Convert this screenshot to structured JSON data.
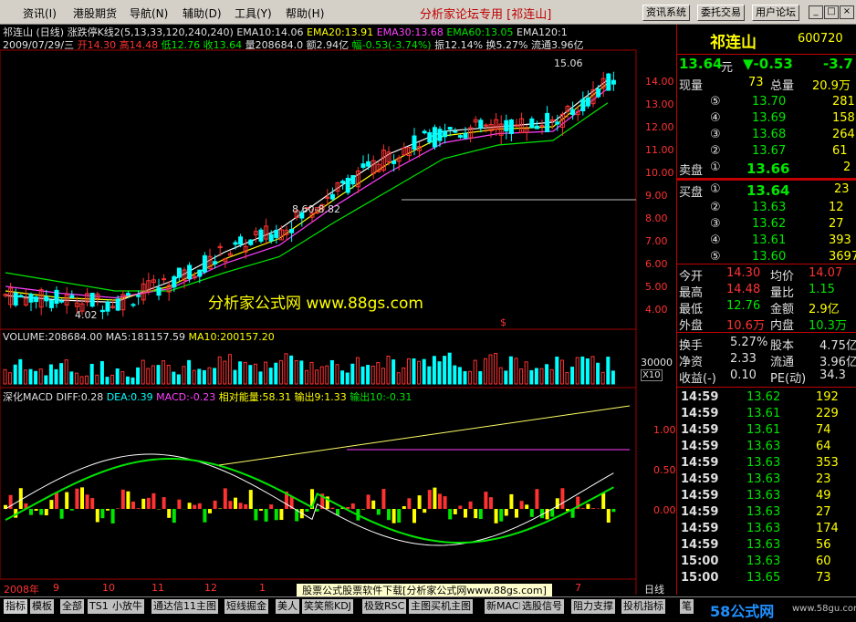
{
  "menu": [
    "资讯(I)",
    "港股期货",
    "导航(N)",
    "辅助(D)",
    "工具(Y)",
    "帮助(H)"
  ],
  "app_title": "分析家论坛专用 [祁连山]",
  "top_buttons": [
    "资讯系统",
    "委托交易",
    "用户论坛"
  ],
  "window_buttons": [
    "_",
    "□",
    "×"
  ],
  "chart": {
    "header_line1": {
      "name": "祁连山 (日线) 涨跌停K线2(5,13,33,120,240,240)",
      "ema10": "EMA10:14.06",
      "ema20": "EMA20:13.91",
      "ema30": "EMA30:13.68",
      "ema60": "EMA60:13.05",
      "ema120": "EMA120:1"
    },
    "header_line2": {
      "date": "2009/07/29/三",
      "open": "开14.30",
      "high": "高14.48",
      "low": "低12.76",
      "close": "收13.64",
      "volume": "量208684.0",
      "amount": "额2.94亿",
      "change": "幅-0.53(-3.74%)",
      "amplitude": "振12.14%",
      "turnover": "换5.27%",
      "float": "流通3.96亿"
    },
    "price_axis": [
      "14.00",
      "13.00",
      "12.00",
      "11.00",
      "10.00",
      "9.00",
      "8.00",
      "7.00",
      "6.00",
      "5.00",
      "4.00"
    ],
    "annotations": {
      "high_mark": "15.06",
      "low_mark": "4.02",
      "range_mark": "8.60-8.82",
      "watermark": "分析家公式网 www.88gs.com",
      "dollar": "$"
    },
    "volume_header": {
      "volume": "VOLUME:208684.00",
      "ma5": "MA5:181157.59",
      "ma10": "MA10:200157.20"
    },
    "volume_axis": [
      "30000",
      "X10"
    ],
    "macd_header": {
      "name": "深化MACD",
      "diff": "DIFF:0.28",
      "dea": "DEA:0.39",
      "macd": "MACD:-0.23",
      "energy": "相对能量:58.31",
      "out9": "输出9:1.33",
      "out10": "输出10:-0.31"
    },
    "macd_axis": [
      "1.00",
      "0.50",
      "0.00"
    ],
    "time_axis": [
      "2008年",
      "9",
      "10",
      "11",
      "12",
      "1",
      "2",
      "3",
      "4",
      "5",
      "6",
      "7"
    ],
    "period": "日线"
  },
  "chart_data": {
    "type": "line",
    "title": "祁连山 (日线)",
    "series": [
      {
        "name": "EMA10",
        "values": [
          4.6,
          4.4,
          4.3,
          5.2,
          6.5,
          7.5,
          9.2,
          10.8,
          11.8,
          12.0,
          12.2,
          14.06
        ]
      },
      {
        "name": "EMA20",
        "values": [
          4.8,
          4.5,
          4.4,
          5.0,
          6.2,
          7.1,
          8.8,
          10.4,
          11.6,
          11.9,
          12.0,
          13.91
        ]
      },
      {
        "name": "EMA30",
        "values": [
          5.0,
          4.7,
          4.5,
          4.9,
          6.0,
          6.8,
          8.5,
          10.0,
          11.3,
          11.7,
          11.8,
          13.68
        ]
      },
      {
        "name": "EMA60",
        "values": [
          5.6,
          5.2,
          4.8,
          4.8,
          5.6,
          6.3,
          7.8,
          9.2,
          10.6,
          11.2,
          11.4,
          13.05
        ]
      }
    ],
    "categories": [
      "2008-09",
      "2008-10",
      "2008-11",
      "2008-12",
      "2009-01",
      "2009-02",
      "2009-03",
      "2009-04",
      "2009-05",
      "2009-06",
      "2009-07a",
      "2009-07b"
    ],
    "ylim": [
      4.0,
      15.06
    ]
  },
  "stock": {
    "name": "祁连山",
    "code": "600720",
    "price": "13.64",
    "price_unit": "元",
    "change": "▼-0.53",
    "change_pct": "-3.7",
    "xianliang_label": "现量",
    "xianliang": "73",
    "zongliang_label": "总量",
    "zongliang": "20.9万"
  },
  "sell_orders": [
    {
      "idx": "⑤",
      "price": "13.70",
      "vol": "281"
    },
    {
      "idx": "④",
      "price": "13.69",
      "vol": "158"
    },
    {
      "idx": "③",
      "price": "13.68",
      "vol": "264"
    },
    {
      "idx": "②",
      "price": "13.67",
      "vol": "61"
    }
  ],
  "sell1": {
    "label": "卖盘",
    "idx": "①",
    "price": "13.66",
    "vol": "2"
  },
  "buy1": {
    "label": "买盘",
    "idx": "①",
    "price": "13.64",
    "vol": "23"
  },
  "buy_orders": [
    {
      "idx": "②",
      "price": "13.63",
      "vol": "12"
    },
    {
      "idx": "③",
      "price": "13.62",
      "vol": "27"
    },
    {
      "idx": "④",
      "price": "13.61",
      "vol": "393"
    },
    {
      "idx": "⑤",
      "price": "13.60",
      "vol": "3697"
    }
  ],
  "stats": [
    {
      "l1": "今开",
      "v1": "14.30",
      "l2": "均价",
      "v2": "14.07"
    },
    {
      "l1": "最高",
      "v1": "14.48",
      "l2": "量比",
      "v2": "1.15"
    },
    {
      "l1": "最低",
      "v1": "12.76",
      "l2": "金额",
      "v2": "2.9亿"
    },
    {
      "l1": "外盘",
      "v1": "10.6万",
      "l2": "内盘",
      "v2": "10.3万"
    }
  ],
  "fin": [
    {
      "l1": "换手",
      "v1": "5.27%",
      "l2": "股本",
      "v2": "4.75亿"
    },
    {
      "l1": "净资",
      "v1": "2.33",
      "l2": "流通",
      "v2": "3.96亿"
    },
    {
      "l1": "收益(-)",
      "v1": "0.10",
      "l2": "PE(动)",
      "v2": "34.3"
    }
  ],
  "ticks": [
    {
      "time": "14:59",
      "price": "13.62",
      "vol": "192"
    },
    {
      "time": "14:59",
      "price": "13.61",
      "vol": "229"
    },
    {
      "time": "14:59",
      "price": "13.61",
      "vol": "74"
    },
    {
      "time": "14:59",
      "price": "13.63",
      "vol": "64"
    },
    {
      "time": "14:59",
      "price": "13.63",
      "vol": "353"
    },
    {
      "time": "14:59",
      "price": "13.63",
      "vol": "23"
    },
    {
      "time": "14:59",
      "price": "13.63",
      "vol": "49"
    },
    {
      "time": "14:59",
      "price": "13.63",
      "vol": "27"
    },
    {
      "time": "14:59",
      "price": "13.63",
      "vol": "174"
    },
    {
      "time": "14:59",
      "price": "13.63",
      "vol": "56"
    },
    {
      "time": "15:00",
      "price": "13.63",
      "vol": "60"
    },
    {
      "time": "15:00",
      "price": "13.65",
      "vol": "73"
    }
  ],
  "tabs": [
    "指标",
    "模板",
    "全部",
    "TS1",
    "小放牛",
    "通达信11主图",
    "短线掘金",
    "美人",
    "笑笑熊KDJ",
    "极致RSC",
    "主图买机主图",
    "新MACD",
    "选股信号",
    "阻力支撑",
    "投机指标",
    "笔"
  ],
  "download_banner": "股票公式股票软件下载[分析家公式网www.88gs.com]",
  "brand": "58公式网",
  "brand_url": "www.58gu.com"
}
